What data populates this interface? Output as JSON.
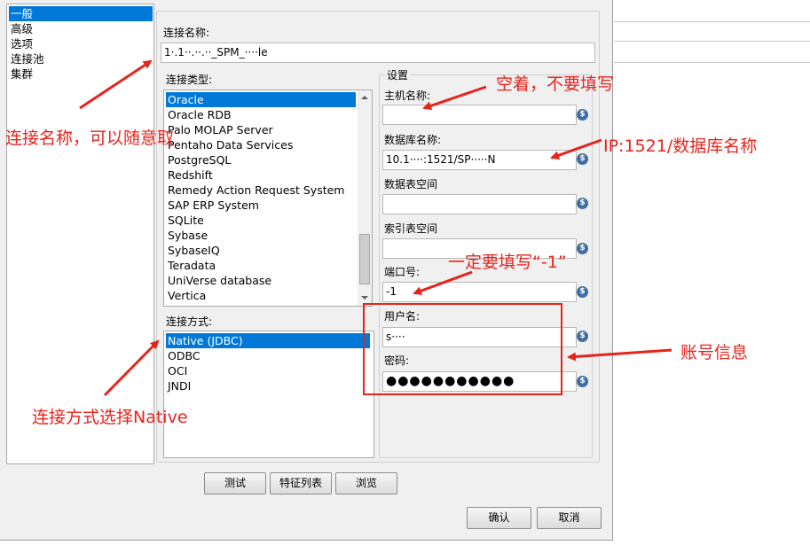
{
  "sidebar": {
    "items": [
      "一般",
      "高级",
      "选项",
      "连接池",
      "集群"
    ],
    "selected_index": 0
  },
  "connection_name": {
    "label": "连接名称:",
    "value": "1·.1··.··.··_SPM_····le"
  },
  "connection_type": {
    "label": "连接类型:",
    "items": [
      "Oracle",
      "Oracle RDB",
      "Palo MOLAP Server",
      "Pentaho Data Services",
      "PostgreSQL",
      "Redshift",
      "Remedy Action Request System",
      "SAP ERP System",
      "SQLite",
      "Sybase",
      "SybaseIQ",
      "Teradata",
      "UniVerse database",
      "Vertica"
    ],
    "selected": "Oracle"
  },
  "access_method": {
    "label": "连接方式:",
    "items": [
      "Native (JDBC)",
      "ODBC",
      "OCI",
      "JNDI"
    ],
    "selected": "Native (JDBC)"
  },
  "settings": {
    "title": "设置",
    "host": {
      "label": "主机名称:",
      "value": ""
    },
    "database": {
      "label": "数据库名称:",
      "value": "10.1····:1521/SP·····N"
    },
    "tablespace_data": {
      "label": "数据表空间",
      "value": ""
    },
    "tablespace_index": {
      "label": "索引表空间",
      "value": ""
    },
    "port": {
      "label": "端口号:",
      "value": "-1"
    },
    "username": {
      "label": "用户名:",
      "value": "s····"
    },
    "password": {
      "label": "密码:",
      "value": "●●●●●●●●●●●"
    }
  },
  "variable_icon": "$",
  "buttons": {
    "test": "测试",
    "features": "特征列表",
    "explore": "浏览",
    "ok": "确认",
    "cancel": "取消"
  },
  "annotations": {
    "conn_name": "连接名称，可以随意取",
    "host": "空着，不要填写",
    "db": "IP:1521/数据库名称",
    "port": "一定要填写“-1”",
    "account": "账号信息",
    "method": "连接方式选择Native"
  },
  "colors": {
    "annotation": "#e8231c",
    "selection": "#0078d7",
    "dialog_bg": "#f0f0f0"
  }
}
